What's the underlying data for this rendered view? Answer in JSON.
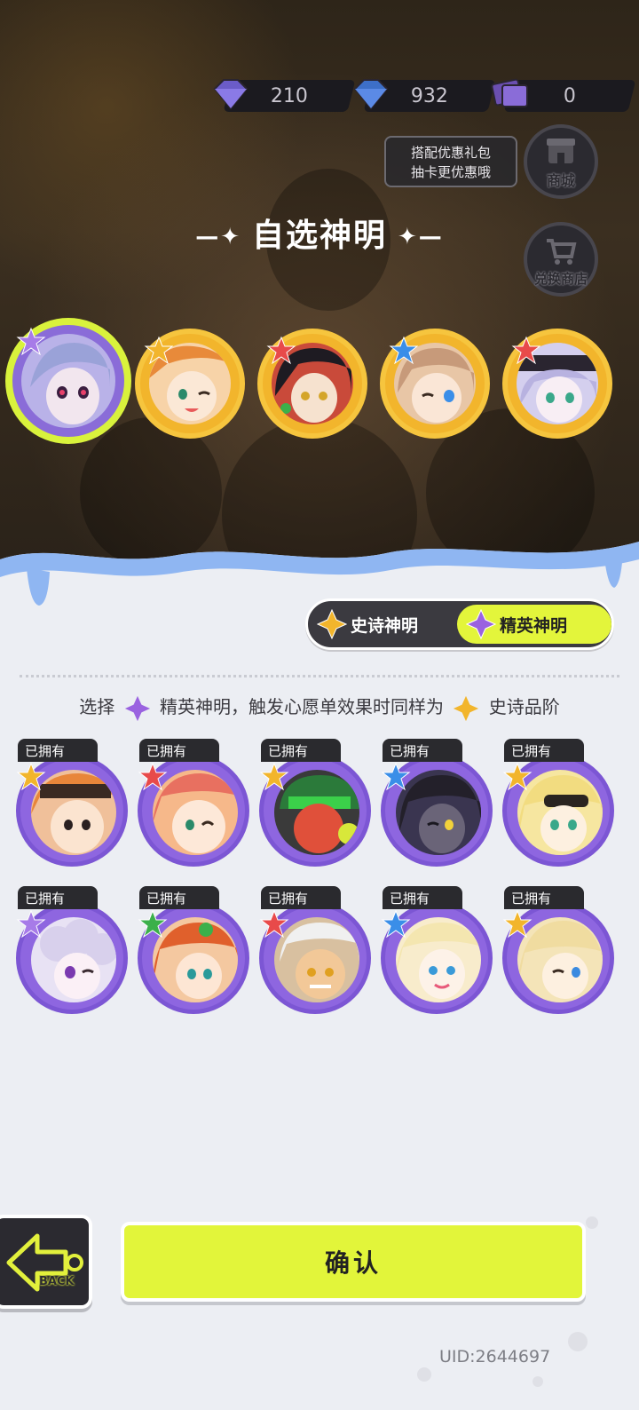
{
  "currencies": [
    {
      "icon": "purple-diamond-icon",
      "value": "210"
    },
    {
      "icon": "blue-diamond-icon",
      "value": "932"
    },
    {
      "icon": "ticket-card-icon",
      "value": "0"
    }
  ],
  "promo": {
    "line1": "搭配优惠礼包",
    "line2": "抽卡更优惠哦"
  },
  "shop": {
    "label": "商城"
  },
  "exchange_shop": {
    "label": "兑换商店"
  },
  "title": "自选神明",
  "featured": [
    {
      "selected": true,
      "rarity_color": "#a77be8",
      "hair": "#9aa2d8"
    },
    {
      "selected": false,
      "rarity_color": "#f2b52c",
      "hair": "#e88a3a"
    },
    {
      "selected": false,
      "rarity_color": "#e84a4a",
      "hair": "#1e1b22"
    },
    {
      "selected": false,
      "rarity_color": "#3a8ee8",
      "hair": "#c79a7a"
    },
    {
      "selected": false,
      "rarity_color": "#e84a4a",
      "hair": "#b8b2e0"
    }
  ],
  "tabs": {
    "epic": "史诗神明",
    "elite": "精英神明"
  },
  "hint": {
    "part1": "选择",
    "part2": "精英神明，触发心愿单效果时同样为",
    "part3": "史诗品阶"
  },
  "owned_label": "已拥有",
  "cards": [
    {
      "star": "#f2b52c",
      "hair": "#e8863a"
    },
    {
      "star": "#e84a4a",
      "hair": "#e87060"
    },
    {
      "star": "#f2b52c",
      "hair": "#2b7a3a"
    },
    {
      "star": "#3a8ee8",
      "hair": "#23202a"
    },
    {
      "star": "#f2b52c",
      "hair": "#f2dc80"
    },
    {
      "star": "#a77be8",
      "hair": "#d8d0ec"
    },
    {
      "star": "#3bb04a",
      "hair": "#e0602c"
    },
    {
      "star": "#e84a4a",
      "hair": "#f0f0f0"
    },
    {
      "star": "#3a8ee8",
      "hair": "#f4e6b0"
    },
    {
      "star": "#f2b52c",
      "hair": "#f0dca0"
    }
  ],
  "back": {
    "label": "BACK"
  },
  "confirm": {
    "label": "确认"
  },
  "uid": "UID:2644697"
}
